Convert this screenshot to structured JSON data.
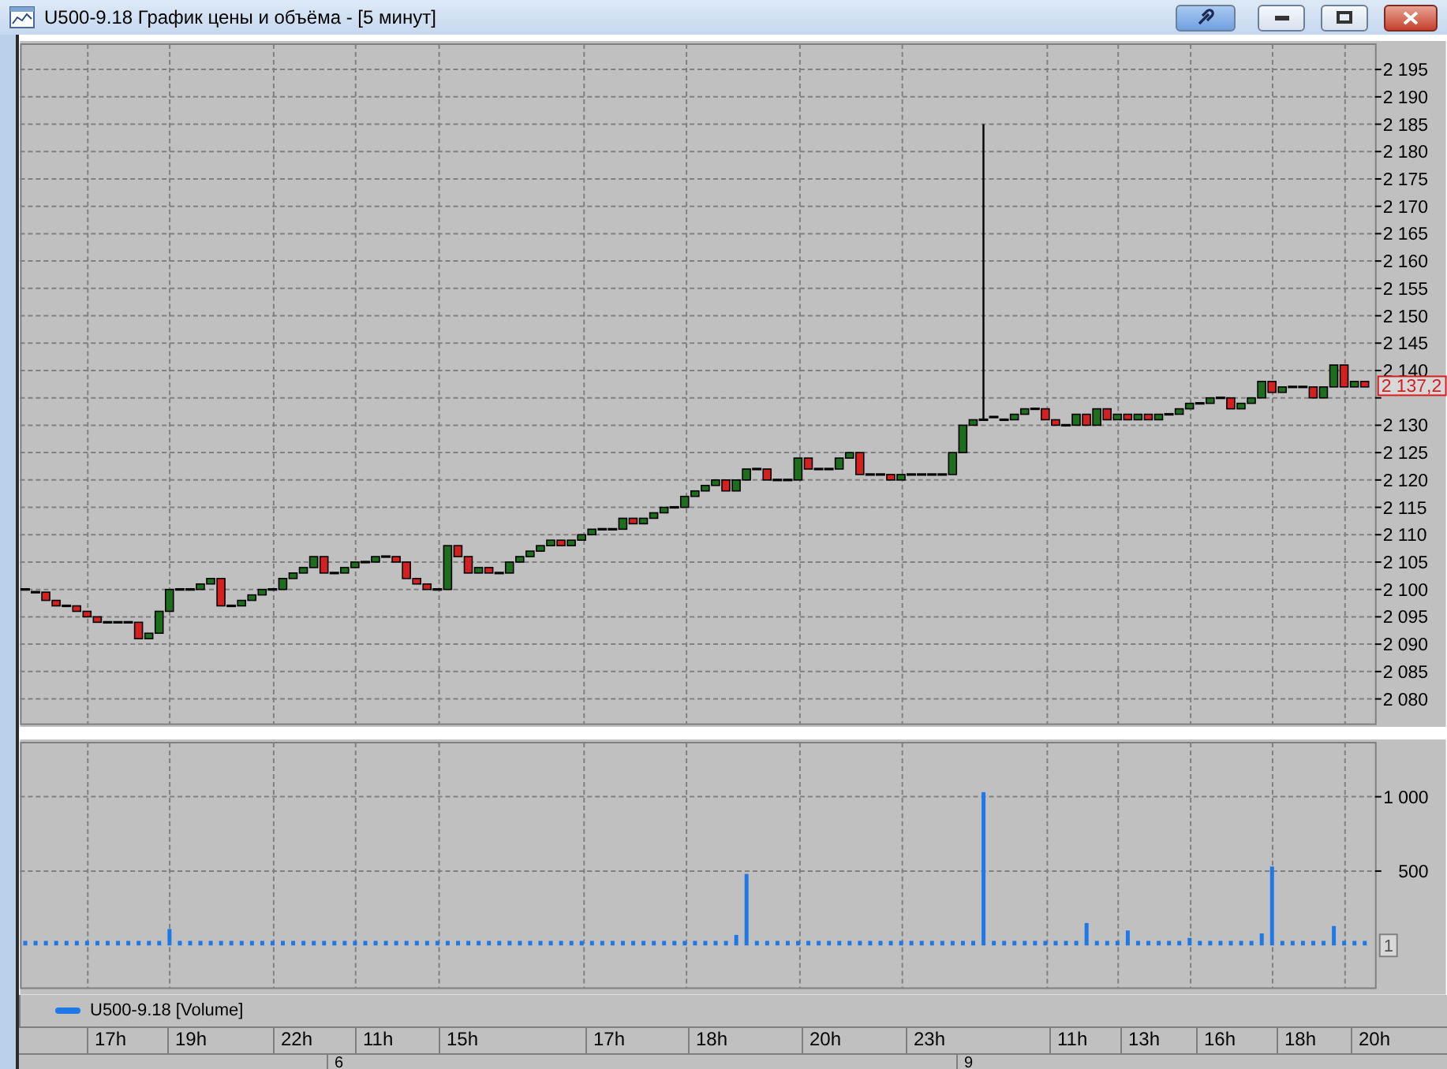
{
  "window": {
    "title": "U500-9.18 График цены и объёма - [5 минут]"
  },
  "price_chart": {
    "price_marker": "2 137,2",
    "axis_labels": [
      "2 195",
      "2 190",
      "2 185",
      "2 180",
      "2 175",
      "2 170",
      "2 165",
      "2 160",
      "2 155",
      "2 150",
      "2 145",
      "2 140",
      "2 130",
      "2 125",
      "2 120",
      "2 115",
      "2 110",
      "2 105",
      "2 100",
      "2 095",
      "2 090",
      "2 085",
      "2 080"
    ]
  },
  "volume_chart": {
    "volume_marker": "1",
    "chart_data": {
      "type": "bar",
      "ylim": [
        -330,
        1385
      ],
      "grid": true,
      "yticks": [
        {
          "value": 500,
          "label": "500"
        },
        {
          "value": 1000,
          "label": "1 000"
        }
      ],
      "series": [
        {
          "name": "U500-9.18 [Volume]",
          "color": "#1e78e6",
          "values": [
            20,
            20,
            20,
            20,
            20,
            20,
            20,
            20,
            20,
            20,
            20,
            20,
            20,
            20,
            100,
            20,
            20,
            20,
            20,
            20,
            20,
            20,
            20,
            20,
            20,
            20,
            20,
            20,
            20,
            20,
            20,
            20,
            20,
            20,
            20,
            20,
            20,
            20,
            20,
            20,
            20,
            20,
            20,
            20,
            20,
            20,
            20,
            20,
            20,
            20,
            20,
            20,
            20,
            20,
            20,
            20,
            20,
            20,
            20,
            20,
            20,
            20,
            20,
            20,
            20,
            20,
            20,
            20,
            20,
            60,
            470,
            20,
            20,
            20,
            20,
            20,
            20,
            20,
            20,
            20,
            20,
            20,
            20,
            20,
            20,
            20,
            20,
            20,
            20,
            20,
            20,
            20,
            20,
            1020,
            20,
            20,
            20,
            20,
            20,
            20,
            20,
            20,
            20,
            140,
            20,
            20,
            20,
            90,
            20,
            20,
            20,
            20,
            20,
            40,
            20,
            20,
            20,
            20,
            20,
            20,
            70,
            520,
            20,
            20,
            20,
            20,
            20,
            120,
            20,
            20,
            20
          ]
        }
      ]
    }
  },
  "time_axis": {
    "hours": [
      "17h",
      "19h",
      "22h",
      "11h",
      "15h",
      "17h",
      "18h",
      "20h",
      "23h",
      "11h",
      "13h",
      "16h",
      "18h",
      "20h"
    ],
    "days": [
      "6",
      "9"
    ]
  }
}
